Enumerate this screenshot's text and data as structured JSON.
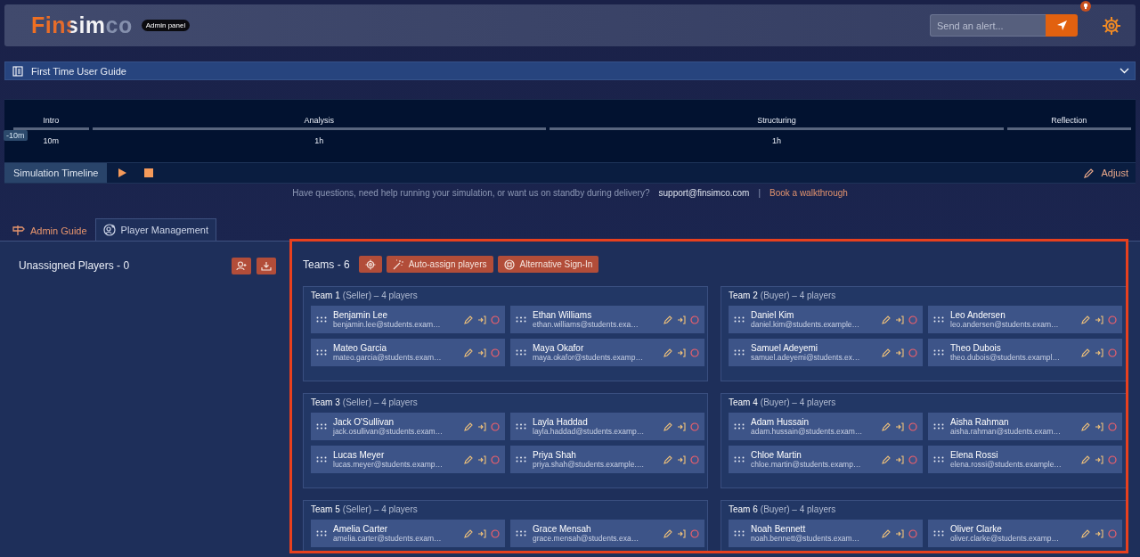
{
  "header": {
    "logo": "Finsimco",
    "badge": "Admin panel",
    "alert": {
      "placeholder": "Send an alert..."
    }
  },
  "guide": {
    "title": "First Time User Guide",
    "expanded": false
  },
  "timeline": {
    "offset": "-10m",
    "phases": [
      {
        "label": "Intro",
        "duration": "10m"
      },
      {
        "label": "Analysis",
        "duration": "1h"
      },
      {
        "label": "Structuring",
        "duration": "1h"
      },
      {
        "label": "Reflection"
      }
    ],
    "tab": "Simulation Timeline",
    "adjust": "Adjust"
  },
  "help": {
    "text": "Have questions, need help running your simulation, or want us on standby during delivery?",
    "email": "support@finsimco.com",
    "separator": "|",
    "link": "Book a walkthrough"
  },
  "tabs": [
    {
      "label": "Admin Guide",
      "selected": false
    },
    {
      "label": "Player Management",
      "selected": true
    }
  ],
  "unassigned": {
    "title": "Unassigned Players - 0"
  },
  "teams_panel": {
    "title": "Teams - 6",
    "buttons": [
      {
        "label": "Auto-assign players"
      },
      {
        "label": "Alternative Sign-In"
      }
    ]
  },
  "teams": [
    {
      "name": "Team 1",
      "detail": "(Seller) – 4 players",
      "players": [
        {
          "name": "Benjamin Lee",
          "email": "benjamin.lee@students.exam…"
        },
        {
          "name": "Ethan Williams",
          "email": "ethan.williams@students.exa…"
        },
        {
          "name": "Mateo Garcia",
          "email": "mateo.garcia@students.exam…"
        },
        {
          "name": "Maya Okafor",
          "email": "maya.okafor@students.examp…"
        }
      ]
    },
    {
      "name": "Team 2",
      "detail": "(Buyer) – 4 players",
      "players": [
        {
          "name": "Daniel Kim",
          "email": "daniel.kim@students.example…"
        },
        {
          "name": "Leo Andersen",
          "email": "leo.andersen@students.exam…"
        },
        {
          "name": "Samuel Adeyemi",
          "email": "samuel.adeyemi@students.ex…"
        },
        {
          "name": "Theo Dubois",
          "email": "theo.dubois@students.exampl…"
        }
      ]
    },
    {
      "name": "Team 3",
      "detail": "(Seller) – 4 players",
      "players": [
        {
          "name": "Jack O'Sullivan",
          "email": "jack.osullivan@students.exam…"
        },
        {
          "name": "Layla Haddad",
          "email": "layla.haddad@students.examp…"
        },
        {
          "name": "Lucas Meyer",
          "email": "lucas.meyer@students.examp…"
        },
        {
          "name": "Priya Shah",
          "email": "priya.shah@students.example.…"
        }
      ]
    },
    {
      "name": "Team 4",
      "detail": "(Buyer) – 4 players",
      "players": [
        {
          "name": "Adam Hussain",
          "email": "adam.hussain@students.exam…"
        },
        {
          "name": "Aisha Rahman",
          "email": "aisha.rahman@students.exam…"
        },
        {
          "name": "Chloe Martin",
          "email": "chloe.martin@students.examp…"
        },
        {
          "name": "Elena Rossi",
          "email": "elena.rossi@students.example…"
        }
      ]
    },
    {
      "name": "Team 5",
      "detail": "(Seller) – 4 players",
      "players": [
        {
          "name": "Amelia Carter",
          "email": "amelia.carter@students.exam…"
        },
        {
          "name": "Grace Mensah",
          "email": "grace.mensah@students.exa…"
        }
      ]
    },
    {
      "name": "Team 6",
      "detail": "(Buyer) – 4 players",
      "players": [
        {
          "name": "Noah Bennett",
          "email": "noah.bennett@students.exam…"
        },
        {
          "name": "Oliver Clarke",
          "email": "oliver.clarke@students.examp…"
        }
      ]
    }
  ]
}
